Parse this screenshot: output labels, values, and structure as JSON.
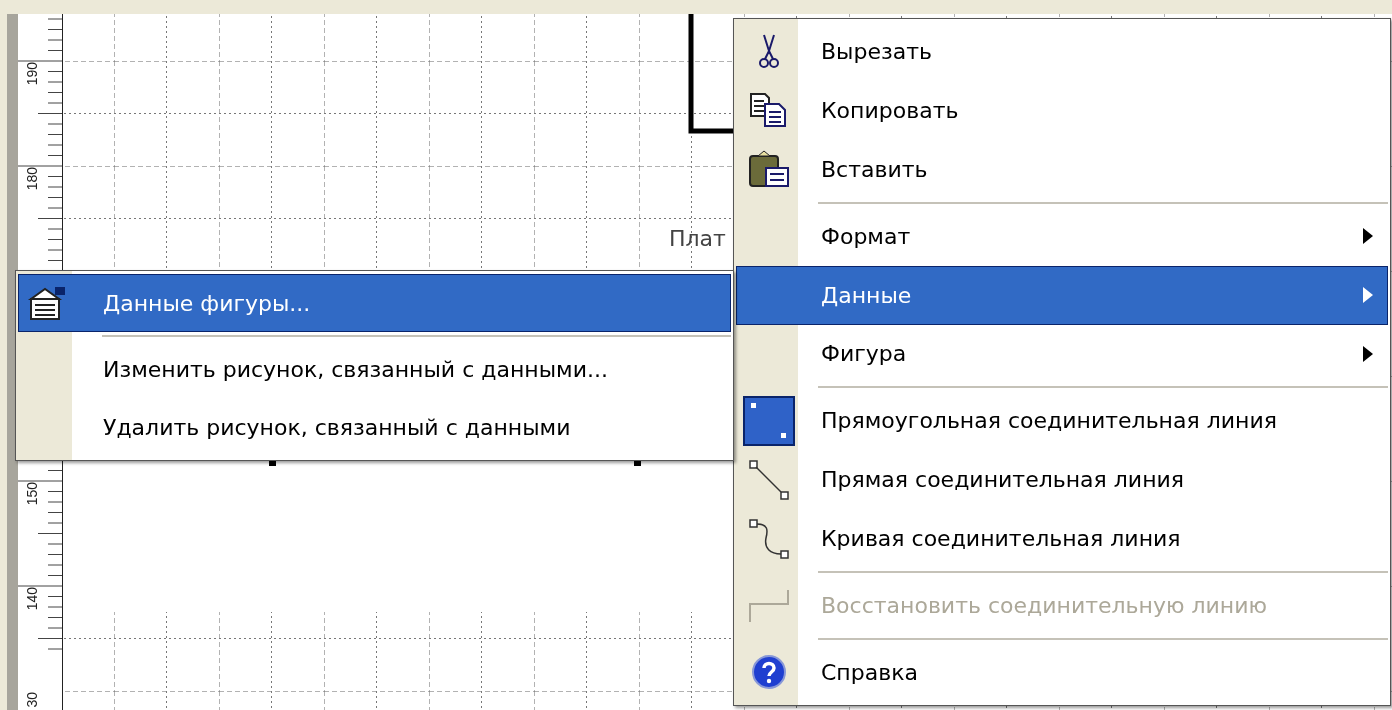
{
  "ruler": {
    "labels": [
      "190",
      "180",
      "150",
      "140",
      "30"
    ]
  },
  "canvas": {
    "labels": [
      "Плат"
    ]
  },
  "submenu": {
    "items": [
      {
        "kind": "item",
        "label": "Данные фигуры...",
        "selected": true
      },
      {
        "kind": "separator"
      },
      {
        "kind": "item",
        "label": "Изменить рисунок, связанный с данными...",
        "selected": false
      },
      {
        "kind": "item",
        "label": "Удалить рисунок, связанный с данными",
        "selected": false
      }
    ]
  },
  "context_menu": {
    "items": [
      {
        "kind": "item",
        "label": "Вырезать",
        "selected": false,
        "disabled": false,
        "has_submenu": false
      },
      {
        "kind": "item",
        "label": "Копировать",
        "selected": false,
        "disabled": false,
        "has_submenu": false
      },
      {
        "kind": "item",
        "label": "Вставить",
        "selected": false,
        "disabled": false,
        "has_submenu": false
      },
      {
        "kind": "separator"
      },
      {
        "kind": "item",
        "label": "Формат",
        "selected": false,
        "disabled": false,
        "has_submenu": true
      },
      {
        "kind": "item",
        "label": "Данные",
        "selected": true,
        "disabled": false,
        "has_submenu": true
      },
      {
        "kind": "item",
        "label": "Фигура",
        "selected": false,
        "disabled": false,
        "has_submenu": true
      },
      {
        "kind": "separator"
      },
      {
        "kind": "item",
        "label": "Прямоугольная соединительная линия",
        "selected": false,
        "disabled": false,
        "has_submenu": false
      },
      {
        "kind": "item",
        "label": "Прямая соединительная линия",
        "selected": false,
        "disabled": false,
        "has_submenu": false
      },
      {
        "kind": "item",
        "label": "Кривая соединительная линия",
        "selected": false,
        "disabled": false,
        "has_submenu": false
      },
      {
        "kind": "separator"
      },
      {
        "kind": "item",
        "label": "Восстановить соединительную линию",
        "selected": false,
        "disabled": true,
        "has_submenu": false
      },
      {
        "kind": "separator"
      },
      {
        "kind": "item",
        "label": "Справка",
        "selected": false,
        "disabled": false,
        "has_submenu": false
      }
    ]
  }
}
